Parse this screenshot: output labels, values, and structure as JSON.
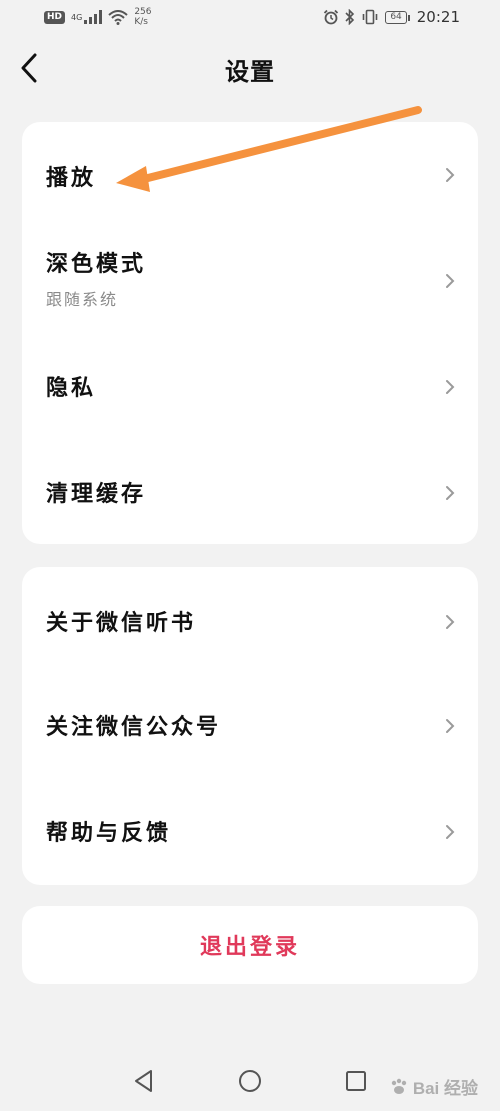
{
  "status_bar": {
    "hd_label": "HD",
    "signal_label": "4G",
    "net_speed_value": "256",
    "net_speed_unit": "K/s",
    "battery_level": "64",
    "time": "20:21"
  },
  "header": {
    "title": "设置"
  },
  "group1": {
    "items": [
      {
        "label": "播放"
      },
      {
        "label": "深色模式",
        "sublabel": "跟随系统"
      },
      {
        "label": "隐私"
      },
      {
        "label": "清理缓存"
      }
    ]
  },
  "group2": {
    "items": [
      {
        "label": "关于微信听书"
      },
      {
        "label": "关注微信公众号"
      },
      {
        "label": "帮助与反馈"
      }
    ]
  },
  "logout": {
    "label": "退出登录"
  },
  "watermark": {
    "text": "Bai 经验"
  },
  "colors": {
    "background": "#f2f2f2",
    "card": "#ffffff",
    "logout_text": "#e0395a",
    "annotation_arrow": "#f5923e",
    "chevron": "#9a9a9a"
  },
  "icons": {
    "back": "chevron-left-icon",
    "row": "chevron-right-icon",
    "nav_back": "triangle-back-icon",
    "nav_home": "circle-home-icon",
    "nav_recent": "square-recent-icon"
  }
}
